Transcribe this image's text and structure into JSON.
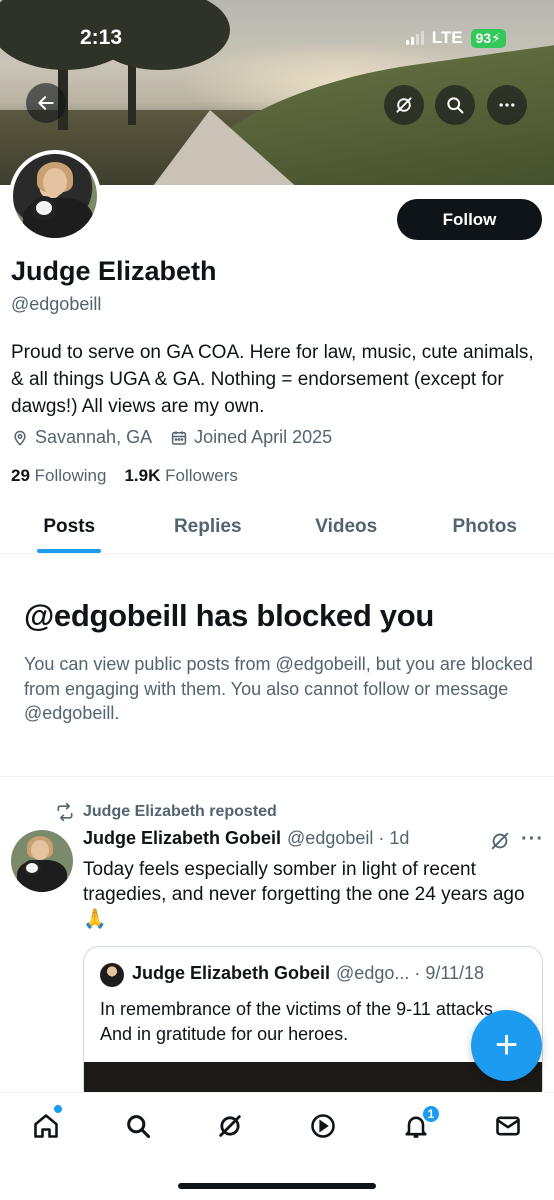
{
  "status_bar": {
    "time": "2:13",
    "network": "LTE",
    "battery": "93"
  },
  "profile": {
    "display_name": "Judge Elizabeth",
    "handle": "@edgobeill",
    "follow_label": "Follow",
    "bio": "Proud to serve on GA COA. Here for law, music, cute animals, & all things UGA & GA. Nothing = endorsement (except for dawgs!) All views are my own.",
    "location": "Savannah, GA",
    "joined": "Joined April 2025",
    "following_count": "29",
    "following_label": "Following",
    "followers_count": "1.9K",
    "followers_label": "Followers"
  },
  "tabs": [
    {
      "label": "Posts",
      "active": true
    },
    {
      "label": "Replies",
      "active": false
    },
    {
      "label": "Videos",
      "active": false
    },
    {
      "label": "Photos",
      "active": false
    }
  ],
  "blocked": {
    "title": "@edgobeill has blocked you",
    "message": "You can view public posts from @edgobeill, but you are blocked from engaging with them. You also cannot follow or message @edgobeill."
  },
  "post": {
    "repost_label": "Judge Elizabeth reposted",
    "author_name": "Judge Elizabeth Gobeil",
    "author_meta": "@edgobeil · 1d",
    "text": "Today feels especially somber in light of recent tragedies, and never forgetting the one 24 years ago 🙏",
    "quote": {
      "author_name": "Judge Elizabeth Gobeil",
      "author_meta": "@edgo... · 9/11/18",
      "text": "In remembrance of the victims of the 9-11 attacks.  And in gratitude for our heroes."
    }
  },
  "fab_label": "+",
  "nav": {
    "notifications_badge": "1"
  },
  "icons": {
    "back": "back-arrow-icon",
    "grok": "grok-icon",
    "search": "search-icon",
    "more": "more-icon",
    "location": "location-pin-icon",
    "calendar": "calendar-icon",
    "repost": "repost-icon",
    "home": "home-icon",
    "messages": "mail-icon",
    "notifications": "bell-icon",
    "media": "play-icon"
  },
  "colors": {
    "accent": "#1d9bf0",
    "text": "#0f1419",
    "secondary": "#536471",
    "battery": "#34c759"
  }
}
